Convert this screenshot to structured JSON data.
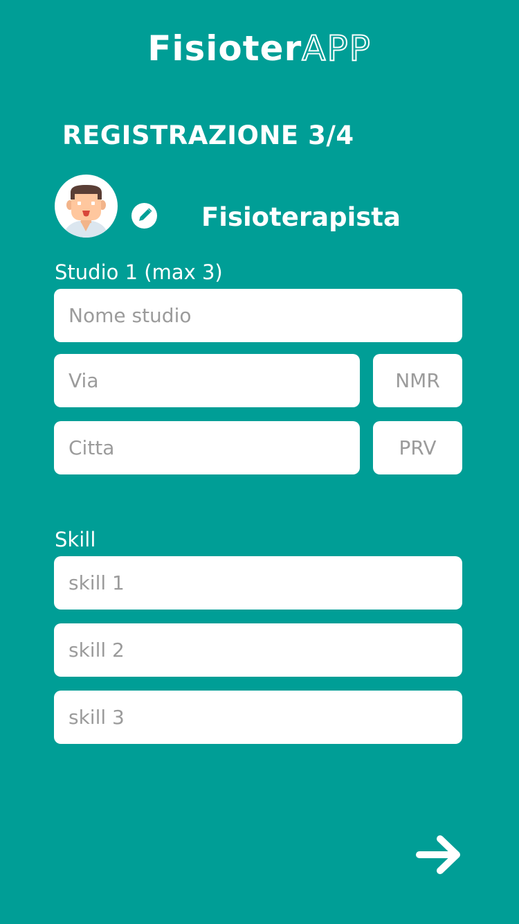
{
  "app": {
    "logo_bold": "Fisioter",
    "logo_outline": "APP"
  },
  "header": {
    "step_title": "REGISTRAZIONE 3/4"
  },
  "profile": {
    "avatar_icon": "avatar-icon",
    "edit_icon": "pencil-icon",
    "role": "Fisioterapista"
  },
  "studio": {
    "label": "Studio 1 (max 3)",
    "name_placeholder": "Nome studio",
    "street_placeholder": "Via",
    "number_placeholder": "NMR",
    "city_placeholder": "Citta",
    "province_placeholder": "PRV"
  },
  "skills": {
    "label": "Skill",
    "skill1_placeholder": "skill 1",
    "skill2_placeholder": "skill 2",
    "skill3_placeholder": "skill 3"
  },
  "footer": {
    "next_icon": "arrow-right-icon"
  },
  "colors": {
    "background": "#009e96",
    "field_background": "#ffffff",
    "placeholder": "#9b9b9b"
  }
}
